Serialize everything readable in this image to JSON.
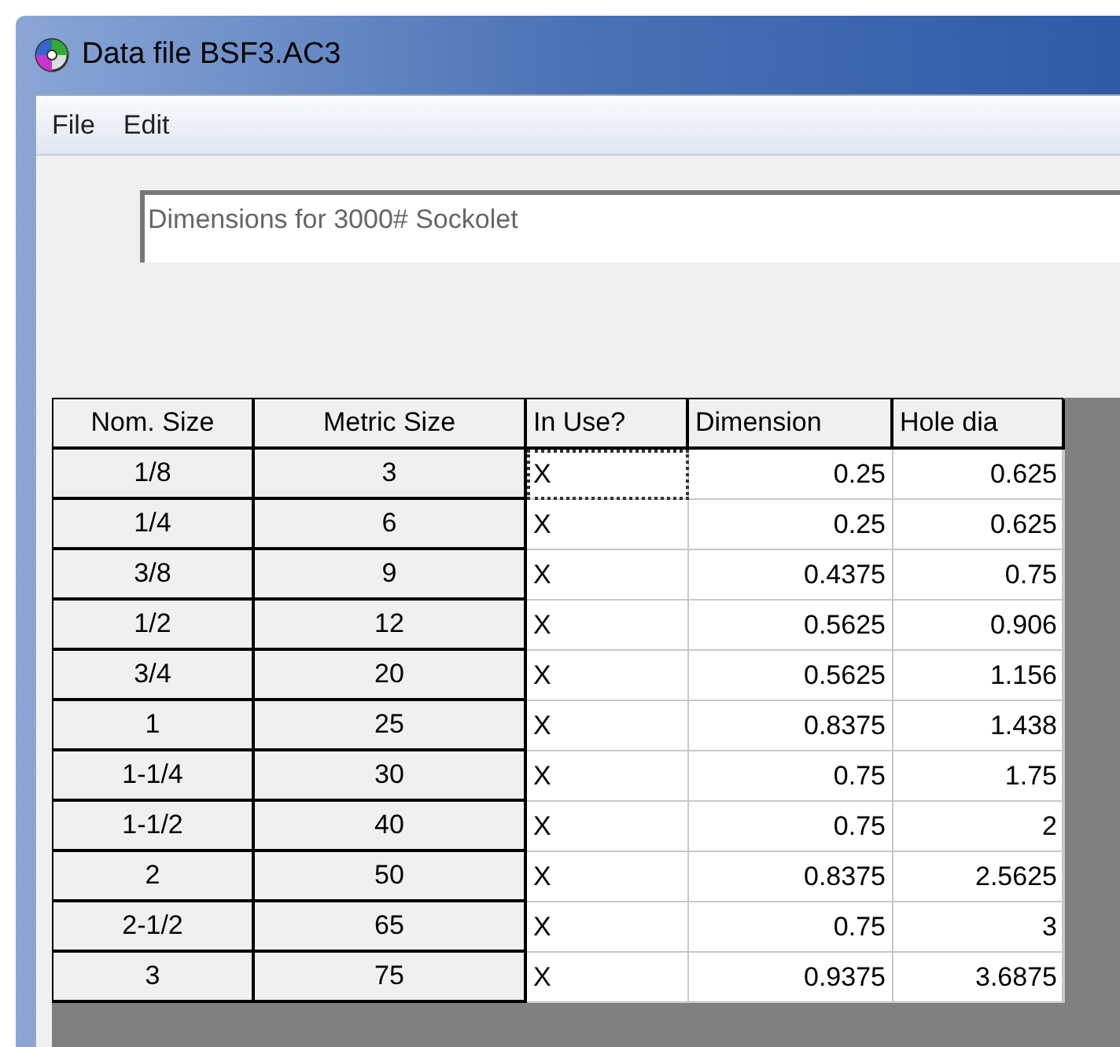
{
  "window": {
    "title": "Data file BSF3.AC3"
  },
  "menu": [
    "File",
    "Edit"
  ],
  "description": {
    "value": "Dimensions for 3000# Sockolet"
  },
  "table": {
    "columns": [
      "Nom. Size",
      "Metric Size",
      "In Use?",
      "Dimension",
      "Hole dia"
    ],
    "rows": [
      {
        "nom": "1/8",
        "metric": "3",
        "in_use": "X",
        "dimension": "0.25",
        "hole": "0.625",
        "focused": true
      },
      {
        "nom": "1/4",
        "metric": "6",
        "in_use": "X",
        "dimension": "0.25",
        "hole": "0.625",
        "focused": false
      },
      {
        "nom": "3/8",
        "metric": "9",
        "in_use": "X",
        "dimension": "0.4375",
        "hole": "0.75",
        "focused": false
      },
      {
        "nom": "1/2",
        "metric": "12",
        "in_use": "X",
        "dimension": "0.5625",
        "hole": "0.906",
        "focused": false
      },
      {
        "nom": "3/4",
        "metric": "20",
        "in_use": "X",
        "dimension": "0.5625",
        "hole": "1.156",
        "focused": false
      },
      {
        "nom": "1",
        "metric": "25",
        "in_use": "X",
        "dimension": "0.8375",
        "hole": "1.438",
        "focused": false
      },
      {
        "nom": "1-1/4",
        "metric": "30",
        "in_use": "X",
        "dimension": "0.75",
        "hole": "1.75",
        "focused": false
      },
      {
        "nom": "1-1/2",
        "metric": "40",
        "in_use": "X",
        "dimension": "0.75",
        "hole": "2",
        "focused": false
      },
      {
        "nom": "2",
        "metric": "50",
        "in_use": "X",
        "dimension": "0.8375",
        "hole": "2.5625",
        "focused": false
      },
      {
        "nom": "2-1/2",
        "metric": "65",
        "in_use": "X",
        "dimension": "0.75",
        "hole": "3",
        "focused": false
      },
      {
        "nom": "3",
        "metric": "75",
        "in_use": "X",
        "dimension": "0.9375",
        "hole": "3.6875",
        "focused": false
      }
    ]
  }
}
